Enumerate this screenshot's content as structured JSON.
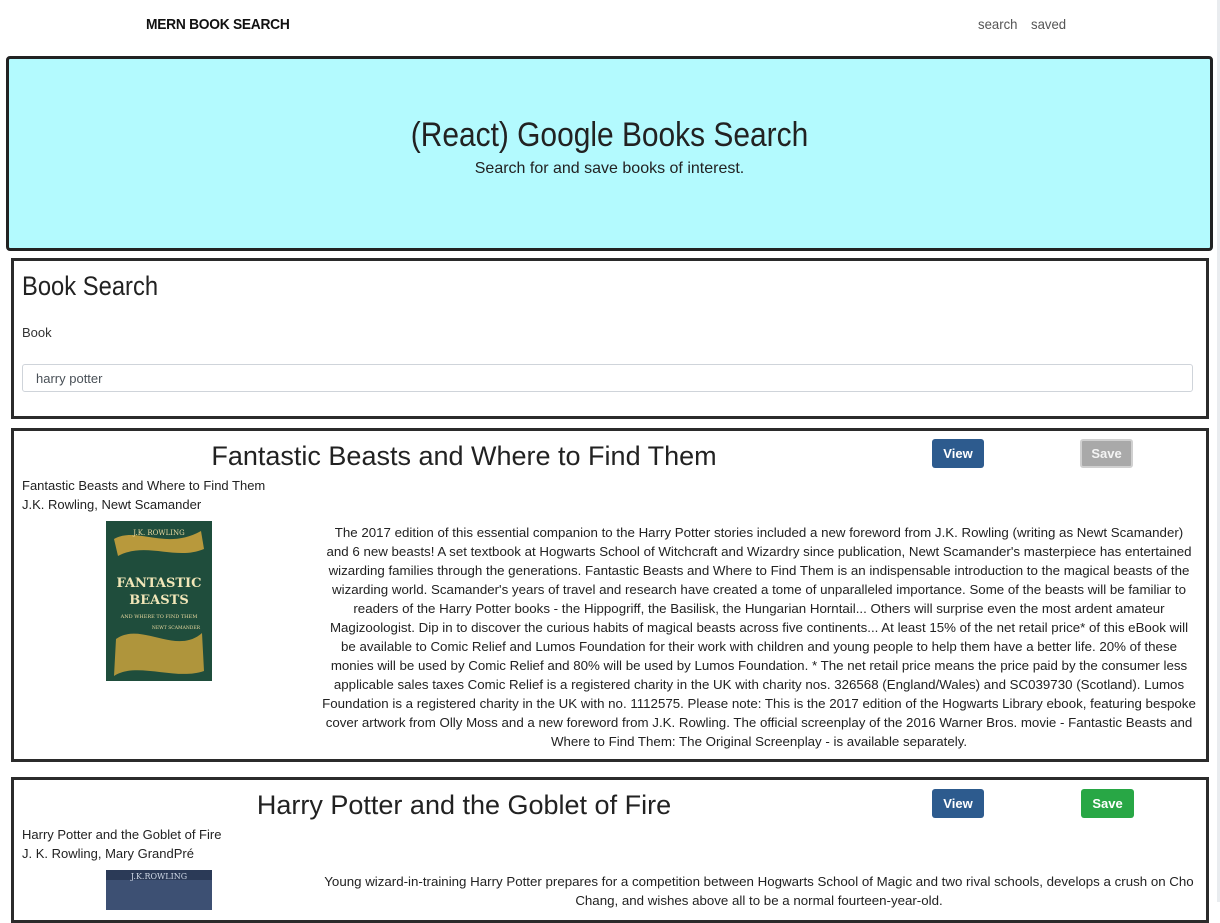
{
  "nav": {
    "brand": "MERN BOOK SEARCH",
    "links": [
      "search",
      "saved"
    ]
  },
  "jumbotron": {
    "title": "(React) Google Books Search",
    "subtitle": "Search for and save books of interest."
  },
  "search": {
    "heading": "Book Search",
    "label": "Book",
    "value": "harry potter"
  },
  "books": [
    {
      "title": "Fantastic Beasts and Where to Find Them",
      "subtitle": "Fantastic Beasts and Where to Find Them",
      "authors": "J.K. Rowling, Newt Scamander",
      "view_label": "View",
      "save_label": "Save",
      "saved": true,
      "cover": {
        "top_text": "J.K. ROWLING",
        "line1": "FANTASTIC",
        "line2": "BEASTS",
        "line3": "AND WHERE TO FIND THEM",
        "line4": "NEWT SCAMANDER",
        "color": "#1f4d3c",
        "accent": "#c9a23c"
      },
      "description": "The 2017 edition of this essential companion to the Harry Potter stories included a new foreword from J.K. Rowling (writing as Newt Scamander) and 6 new beasts! A set textbook at Hogwarts School of Witchcraft and Wizardry since publication, Newt Scamander's masterpiece has entertained wizarding families through the generations. Fantastic Beasts and Where to Find Them is an indispensable introduction to the magical beasts of the wizarding world. Scamander's years of travel and research have created a tome of unparalleled importance. Some of the beasts will be familiar to readers of the Harry Potter books - the Hippogriff, the Basilisk, the Hungarian Horntail... Others will surprise even the most ardent amateur Magizoologist. Dip in to discover the curious habits of magical beasts across five continents... At least 15% of the net retail price* of this eBook will be available to Comic Relief and Lumos Foundation for their work with children and young people to help them have a better life. 20% of these monies will be used by Comic Relief and 80% will be used by Lumos Foundation. * The net retail price means the price paid by the consumer less applicable sales taxes Comic Relief is a registered charity in the UK with charity nos. 326568 (England/Wales) and SC039730 (Scotland). Lumos Foundation is a registered charity in the UK with no. 1112575. Please note: This is the 2017 edition of the Hogwarts Library ebook, featuring bespoke cover artwork from Olly Moss and a new foreword from J.K. Rowling. The official screenplay of the 2016 Warner Bros. movie - Fantastic Beasts and Where to Find Them: The Original Screenplay - is available separately."
    },
    {
      "title": "Harry Potter and the Goblet of Fire",
      "subtitle": "Harry Potter and the Goblet of Fire",
      "authors": "J. K. Rowling, Mary GrandPré",
      "view_label": "View",
      "save_label": "Save",
      "saved": false,
      "cover": {
        "top_text": "J.K.ROWLING",
        "color": "#2b3a57"
      },
      "description": "Young wizard-in-training Harry Potter prepares for a competition between Hogwarts School of Magic and two rival schools, develops a crush on Cho Chang, and wishes above all to be a normal fourteen-year-old."
    }
  ],
  "colors": {
    "jumbotron_bg": "#b3fafe",
    "view_button": "#2d5b8e",
    "save_button": "#28a745",
    "saved_button": "#a9a9a9"
  }
}
